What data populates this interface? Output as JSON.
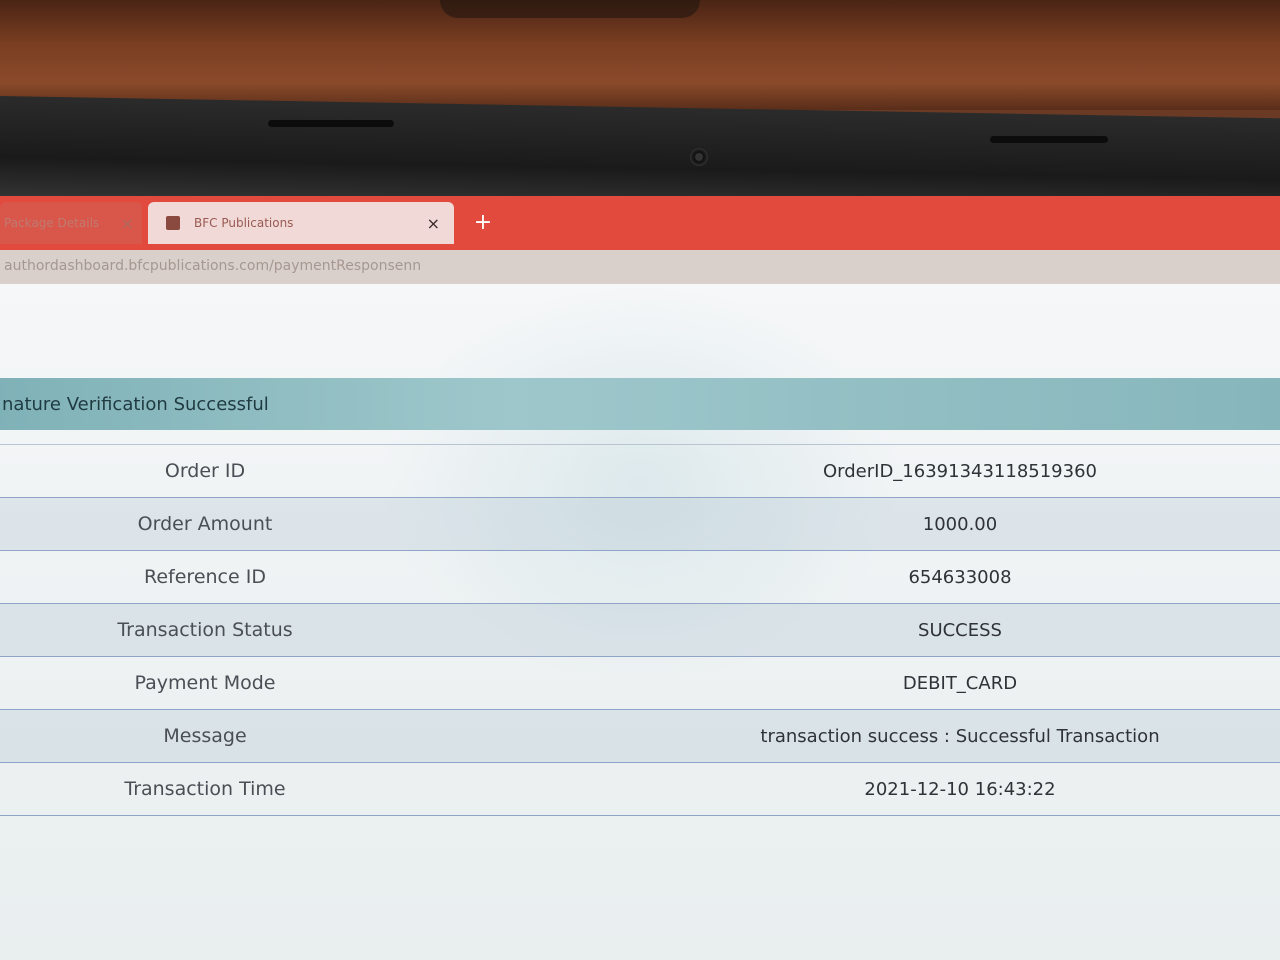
{
  "browser": {
    "tabs": [
      {
        "title": "Package Details"
      },
      {
        "title": "BFC Publications"
      }
    ],
    "new_tab_symbol": "+",
    "close_symbol": "×",
    "url": "authordashboard.bfcpublications.com/paymentResponsenn"
  },
  "alert": {
    "text": "nature Verification Successful"
  },
  "transaction": {
    "rows": [
      {
        "label": "Order ID",
        "value": "OrderID_16391343118519360"
      },
      {
        "label": "Order Amount",
        "value": "1000.00"
      },
      {
        "label": "Reference ID",
        "value": "654633008"
      },
      {
        "label": "Transaction Status",
        "value": "SUCCESS"
      },
      {
        "label": "Payment Mode",
        "value": "DEBIT_CARD"
      },
      {
        "label": "Message",
        "value": "transaction success : Successful Transaction"
      },
      {
        "label": "Transaction Time",
        "value": "2021-12-10 16:43:22"
      }
    ]
  },
  "colors": {
    "tab_strip": "#e24a3e",
    "alert_bg": "#9ec7cb",
    "row_border": "#8fa4c6"
  }
}
